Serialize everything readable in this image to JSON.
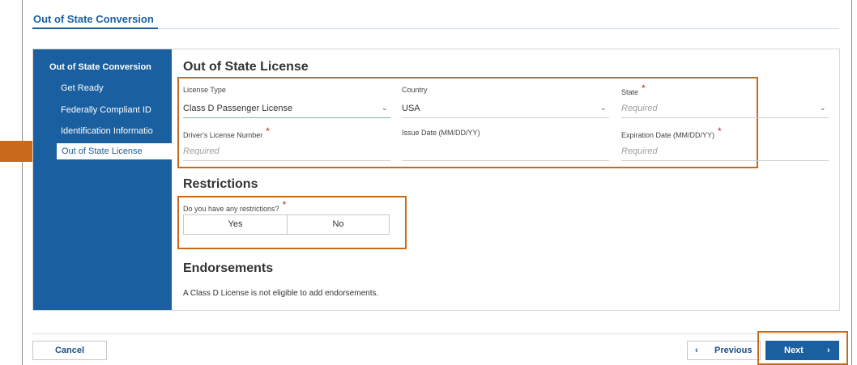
{
  "page": {
    "title": "Out of State Conversion"
  },
  "sidebar": {
    "header": "Out of State Conversion",
    "items": [
      {
        "label": "Get Ready"
      },
      {
        "label": "Federally Compliant ID"
      },
      {
        "label": "Identification Informatio"
      },
      {
        "label": "Out of State License",
        "active": true
      }
    ]
  },
  "license_section": {
    "title": "Out of State License",
    "license_type": {
      "label": "License Type",
      "value": "Class D Passenger License"
    },
    "country": {
      "label": "Country",
      "value": "USA"
    },
    "state": {
      "label": "State",
      "required": true,
      "placeholder": "Required"
    },
    "license_number": {
      "label": "Driver's License Number",
      "required": true,
      "placeholder": "Required"
    },
    "issue_date": {
      "label": "Issue Date (MM/DD/YY)",
      "placeholder": ""
    },
    "expiration_date": {
      "label": "Expiration Date (MM/DD/YY)",
      "required": true,
      "placeholder": "Required"
    },
    "required_mark": "*"
  },
  "restrictions": {
    "title": "Restrictions",
    "question": "Do you have any restrictions?",
    "yes_label": "Yes",
    "no_label": "No"
  },
  "endorsements": {
    "title": "Endorsements",
    "message": "A Class D License is not eligible to add endorsements."
  },
  "footer": {
    "cancel_label": "Cancel",
    "previous_label": "Previous",
    "next_label": "Next",
    "prev_chevron": "‹",
    "next_chevron": "›"
  },
  "icons": {
    "dropdown": "chevron-down-icon"
  },
  "colors": {
    "primary": "#1a5fa0",
    "highlight": "#c86a1c",
    "required": "#cc2222"
  }
}
